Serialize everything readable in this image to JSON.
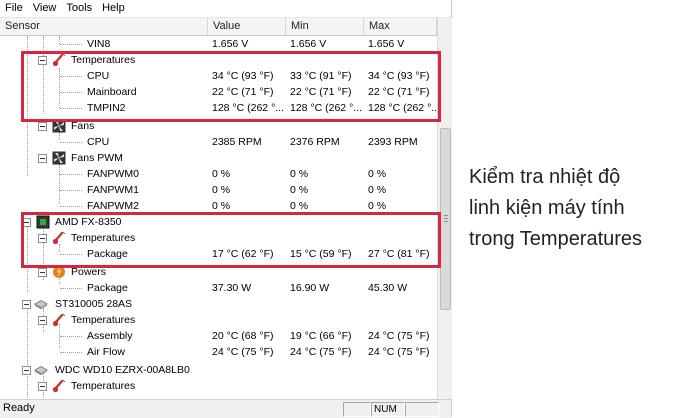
{
  "menu": [
    "File",
    "View",
    "Tools",
    "Help"
  ],
  "columns": {
    "sensor": "Sensor",
    "value": "Value",
    "min": "Min",
    "max": "Max"
  },
  "rows": {
    "vin8": {
      "label": "VIN8",
      "value": "1.656 V",
      "min": "1.656 V",
      "max": "1.656 V"
    },
    "temps1": {
      "label": "Temperatures"
    },
    "cpu_temp": {
      "label": "CPU",
      "value": "34 °C  (93 °F)",
      "min": "33 °C  (91 °F)",
      "max": "34 °C  (93 °F)"
    },
    "mainboard": {
      "label": "Mainboard",
      "value": "22 °C  (71 °F)",
      "min": "22 °C  (71 °F)",
      "max": "22 °C  (71 °F)"
    },
    "tmpin2": {
      "label": "TMPIN2",
      "value": "128 °C  (262 °...",
      "min": "128 °C  (262 °...",
      "max": "128 °C  (262 °..."
    },
    "fans": {
      "label": "Fans"
    },
    "fan_cpu": {
      "label": "CPU",
      "value": "2385 RPM",
      "min": "2376 RPM",
      "max": "2393 RPM"
    },
    "fans_pwm": {
      "label": "Fans PWM"
    },
    "fanpwm0": {
      "label": "FANPWM0",
      "value": "0 %",
      "min": "0 %",
      "max": "0 %"
    },
    "fanpwm1": {
      "label": "FANPWM1",
      "value": "0 %",
      "min": "0 %",
      "max": "0 %"
    },
    "fanpwm2": {
      "label": "FANPWM2",
      "value": "0 %",
      "min": "0 %",
      "max": "0 %"
    },
    "amd": {
      "label": "AMD FX-8350"
    },
    "temps2": {
      "label": "Temperatures"
    },
    "package_temp": {
      "label": "Package",
      "value": "17 °C  (62 °F)",
      "min": "15 °C  (59 °F)",
      "max": "27 °C  (81 °F)"
    },
    "powers": {
      "label": "Powers"
    },
    "package_power": {
      "label": "Package",
      "value": "37.30 W",
      "min": "16.90 W",
      "max": "45.30 W"
    },
    "st310005": {
      "label": "ST310005 28AS"
    },
    "temps3": {
      "label": "Temperatures"
    },
    "assembly": {
      "label": "Assembly",
      "value": "20 °C  (68 °F)",
      "min": "19 °C  (66 °F)",
      "max": "24 °C  (75 °F)"
    },
    "airflow": {
      "label": "Air Flow",
      "value": "24 °C  (75 °F)",
      "min": "24 °C  (75 °F)",
      "max": "24 °C  (75 °F)"
    },
    "wdc": {
      "label": "WDC WD10 EZRX-00A8LB0"
    },
    "temps4": {
      "label": "Temperatures"
    }
  },
  "status": {
    "ready": "Ready",
    "num": "NUM"
  },
  "caption": {
    "line1": "Kiểm tra nhiệt độ",
    "line2": "linh kiện máy tính",
    "line3": "trong Temperatures"
  },
  "colors": {
    "highlight_box": "#d7263d"
  }
}
